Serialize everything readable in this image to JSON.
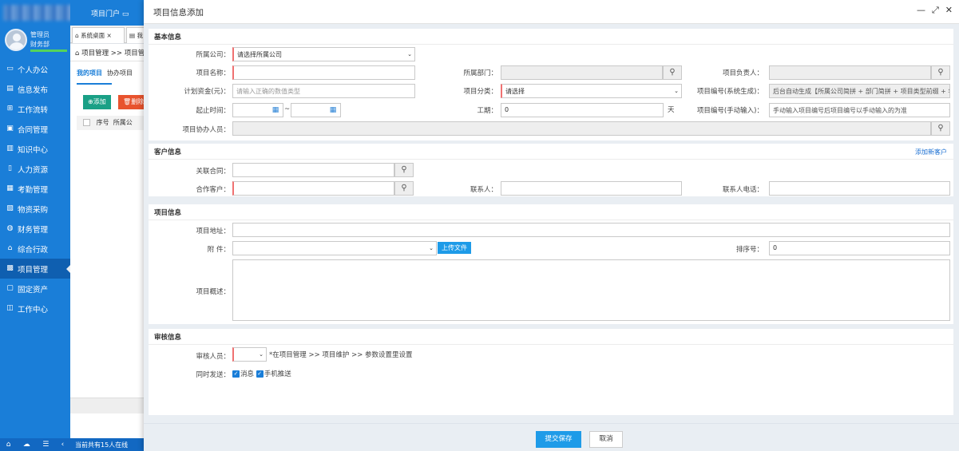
{
  "sidebar": {
    "user": {
      "name": "管理员",
      "dept": "财务部"
    },
    "items": [
      {
        "label": "个人办公",
        "icon": "desktop-icon"
      },
      {
        "label": "信息发布",
        "icon": "megaphone-icon"
      },
      {
        "label": "工作流转",
        "icon": "workflow-icon"
      },
      {
        "label": "合同管理",
        "icon": "contract-icon"
      },
      {
        "label": "知识中心",
        "icon": "book-icon"
      },
      {
        "label": "人力资源",
        "icon": "people-icon"
      },
      {
        "label": "考勤管理",
        "icon": "calendar-icon"
      },
      {
        "label": "物资采购",
        "icon": "cart-icon"
      },
      {
        "label": "财务管理",
        "icon": "money-icon"
      },
      {
        "label": "综合行政",
        "icon": "admin-icon"
      },
      {
        "label": "项目管理",
        "icon": "project-icon"
      },
      {
        "label": "固定资产",
        "icon": "monitor-icon"
      },
      {
        "label": "工作中心",
        "icon": "workspace-icon"
      }
    ],
    "status": "当前共有15人在线"
  },
  "topbar": {
    "portal": "项目门户"
  },
  "tabs": [
    {
      "label": "系统桌面"
    },
    {
      "label": "我"
    }
  ],
  "breadcrumb": "项目管理 >> 项目管",
  "bg_subtabs": [
    "我的项目",
    "协办项目"
  ],
  "bg_buttons": {
    "add": "添加",
    "delete": "删除"
  },
  "bg_table_headers": [
    "序号",
    "所属公"
  ],
  "modal": {
    "title": "项目信息添加",
    "sections": {
      "basic": "基本信息",
      "customer": "客户信息",
      "project": "项目信息",
      "audit": "审核信息"
    },
    "fields": {
      "company": {
        "label": "所属公司：",
        "value": "请选择所属公司"
      },
      "department": {
        "label": "所属部门：",
        "value": ""
      },
      "manager": {
        "label": "项目负责人：",
        "value": ""
      },
      "project_name": {
        "label": "项目名称：",
        "value": ""
      },
      "budget": {
        "label": "计划资金(元)：",
        "placeholder": "请输入正确的数值类型"
      },
      "category": {
        "label": "项目分类：",
        "value": "请选择"
      },
      "code_auto": {
        "label": "项目编号(系统生成)：",
        "value": "后台自动生成【所属公司简拼 + 部门简拼 + 项目类型前缀 + 年"
      },
      "period": {
        "label": "起止时间：",
        "sep": "~"
      },
      "duration": {
        "label": "工期：",
        "value": "0",
        "unit": "天"
      },
      "code_manual": {
        "label": "项目编号(手动输入)：",
        "value": "手动输入项目编号后项目编号以手动输入的为准"
      },
      "assistants": {
        "label": "项目协办人员：",
        "value": ""
      },
      "contract": {
        "label": "关联合同：",
        "value": ""
      },
      "partner": {
        "label": "合作客户：",
        "value": ""
      },
      "contact": {
        "label": "联系人：",
        "value": ""
      },
      "contact_phone": {
        "label": "联系人电话：",
        "value": ""
      },
      "address": {
        "label": "项目地址：",
        "value": ""
      },
      "attachment": {
        "label": "附 件：",
        "value": "",
        "upload": "上传文件"
      },
      "sort_no": {
        "label": "排序号：",
        "value": "0"
      },
      "overview": {
        "label": "项目概述：",
        "value": ""
      },
      "auditor": {
        "label": "审核人员：",
        "value": "",
        "hint": "*在项目管理 >> 项目维护 >> 参数设置里设置"
      },
      "notify": {
        "label": "同时发送：",
        "msg": "消息",
        "sms": "手机推送"
      }
    },
    "add_customer": "添加新客户",
    "submit": "提交保存",
    "cancel": "取消"
  }
}
